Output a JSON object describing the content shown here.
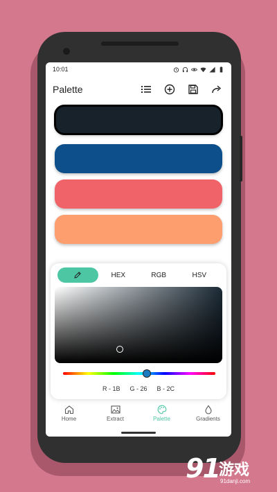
{
  "status_bar": {
    "time": "10:01"
  },
  "app_bar": {
    "title": "Palette"
  },
  "swatches": [
    {
      "name": "color-1",
      "color": "#17222b",
      "selected": true
    },
    {
      "name": "color-2",
      "color": "#0d4f8a",
      "selected": false
    },
    {
      "name": "color-3",
      "color": "#f06368",
      "selected": false
    },
    {
      "name": "color-4",
      "color": "#fd9e6e",
      "selected": false
    }
  ],
  "picker": {
    "tabs": [
      {
        "label": "",
        "icon": "pencil-icon",
        "active": true
      },
      {
        "label": "HEX",
        "active": false
      },
      {
        "label": "RGB",
        "active": false
      },
      {
        "label": "HSV",
        "active": false
      }
    ],
    "readout": {
      "r": "R - 1B",
      "g": "G - 26",
      "b": "B - 2C"
    }
  },
  "bottom_nav": [
    {
      "label": "Home",
      "icon": "home-icon",
      "active": false
    },
    {
      "label": "Extract",
      "icon": "image-icon",
      "active": false
    },
    {
      "label": "Palette",
      "icon": "palette-icon",
      "active": true
    },
    {
      "label": "Gradients",
      "icon": "drop-icon",
      "active": false
    }
  ],
  "colors": {
    "accent": "#4dc6a3",
    "background": "#d4788e"
  },
  "watermark": {
    "digits": "91",
    "cn": "游戏",
    "url": "91danji.com"
  }
}
